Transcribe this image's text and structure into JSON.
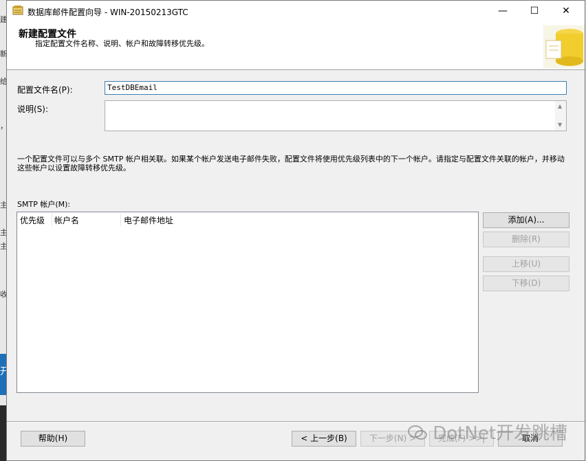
{
  "window": {
    "title": "数据库邮件配置向导 - WIN-20150213GTC",
    "minimize": "—",
    "maximize": "☐",
    "close": "✕"
  },
  "header": {
    "title": "新建配置文件",
    "subtitle": "指定配置文件名称、说明、帐户和故障转移优先级。"
  },
  "form": {
    "name_label": "配置文件名(P):",
    "name_value": "TestDBEmail",
    "description_label": "说明(S):",
    "description_value": ""
  },
  "info_text": "一个配置文件可以与多个 SMTP 帐户相关联。如果某个帐户发送电子邮件失败，配置文件将使用优先级列表中的下一个帐户。请指定与配置文件关联的帐户，并移动这些帐户以设置故障转移优先级。",
  "smtp": {
    "label": "SMTP 帐户(M):",
    "columns": [
      "优先级",
      "帐户名",
      "电子邮件地址"
    ],
    "rows": []
  },
  "buttons": {
    "add": "添加(A)...",
    "remove": "删除(R)",
    "move_up": "上移(U)",
    "move_down": "下移(D)",
    "help": "帮助(H)",
    "back": "< 上一步(B)",
    "next": "下一步(N) >",
    "finish": "完成(F) >>|",
    "cancel": "取消"
  },
  "watermark": "DotNet开发跳槽",
  "background_left": [
    "建",
    "新",
    "给",
    "，",
    "主",
    "主",
    "主",
    "收",
    "开"
  ]
}
